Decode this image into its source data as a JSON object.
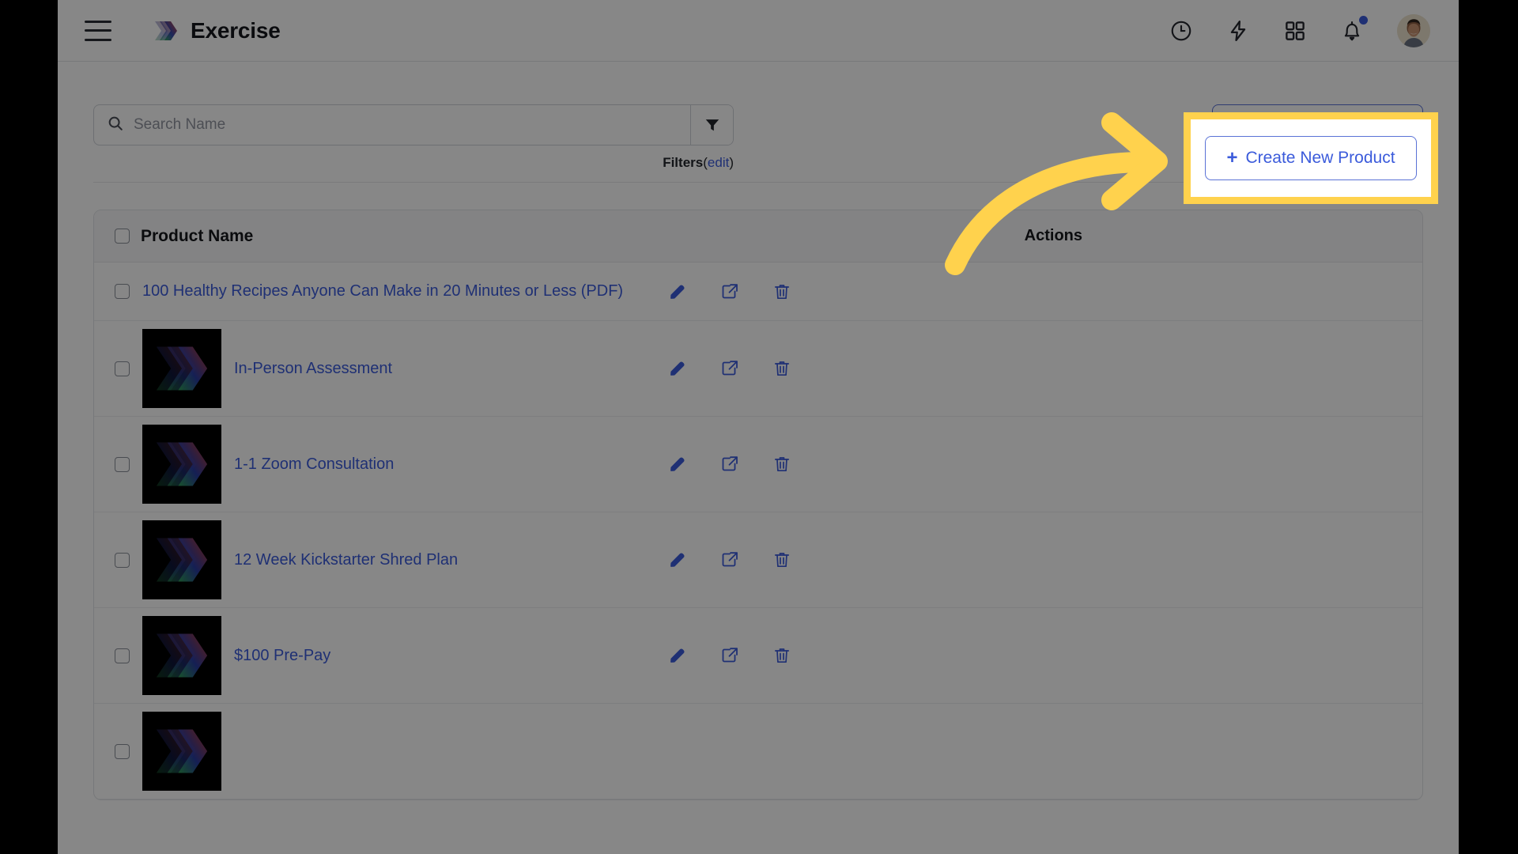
{
  "app": {
    "brand_name": "Exercise",
    "accent_blue": "#3b5bdb",
    "highlight_yellow": "#ffd24d",
    "logo_icon": "chevron-stack-logo"
  },
  "topbar": {
    "menu_icon": "hamburger-menu-icon",
    "icons": [
      {
        "name": "clock-icon",
        "label": "Recent"
      },
      {
        "name": "lightning-bolt-icon",
        "label": "Quick Actions"
      },
      {
        "name": "grid-apps-icon",
        "label": "Apps"
      },
      {
        "name": "bell-icon",
        "label": "Notifications",
        "has_badge": true
      }
    ],
    "avatar_name": "user-avatar"
  },
  "search": {
    "placeholder": "Search Name",
    "value": "",
    "search_icon": "search-icon",
    "filter_icon": "filter-funnel-icon",
    "filters_label": "Filters",
    "filters_edit_label": "edit",
    "paren_open": "(",
    "paren_close": ")"
  },
  "actions": {
    "create_label": "Create New Product",
    "create_plus": "+"
  },
  "table": {
    "columns": {
      "name": "Product Name",
      "actions": "Actions"
    },
    "row_action_icons": [
      "edit-pencil-icon",
      "external-link-icon",
      "delete-trash-icon"
    ],
    "rows": [
      {
        "title": "100 Healthy Recipes Anyone Can Make in 20 Minutes or Less (PDF)",
        "has_thumb": false
      },
      {
        "title": "In-Person Assessment",
        "has_thumb": true
      },
      {
        "title": "1-1 Zoom Consultation",
        "has_thumb": true
      },
      {
        "title": "12 Week Kickstarter Shred Plan",
        "has_thumb": true
      },
      {
        "title": "$100 Pre-Pay",
        "has_thumb": true
      }
    ]
  },
  "callout": {
    "arrow_name": "curved-yellow-arrow",
    "target": "create-new-product-button"
  }
}
